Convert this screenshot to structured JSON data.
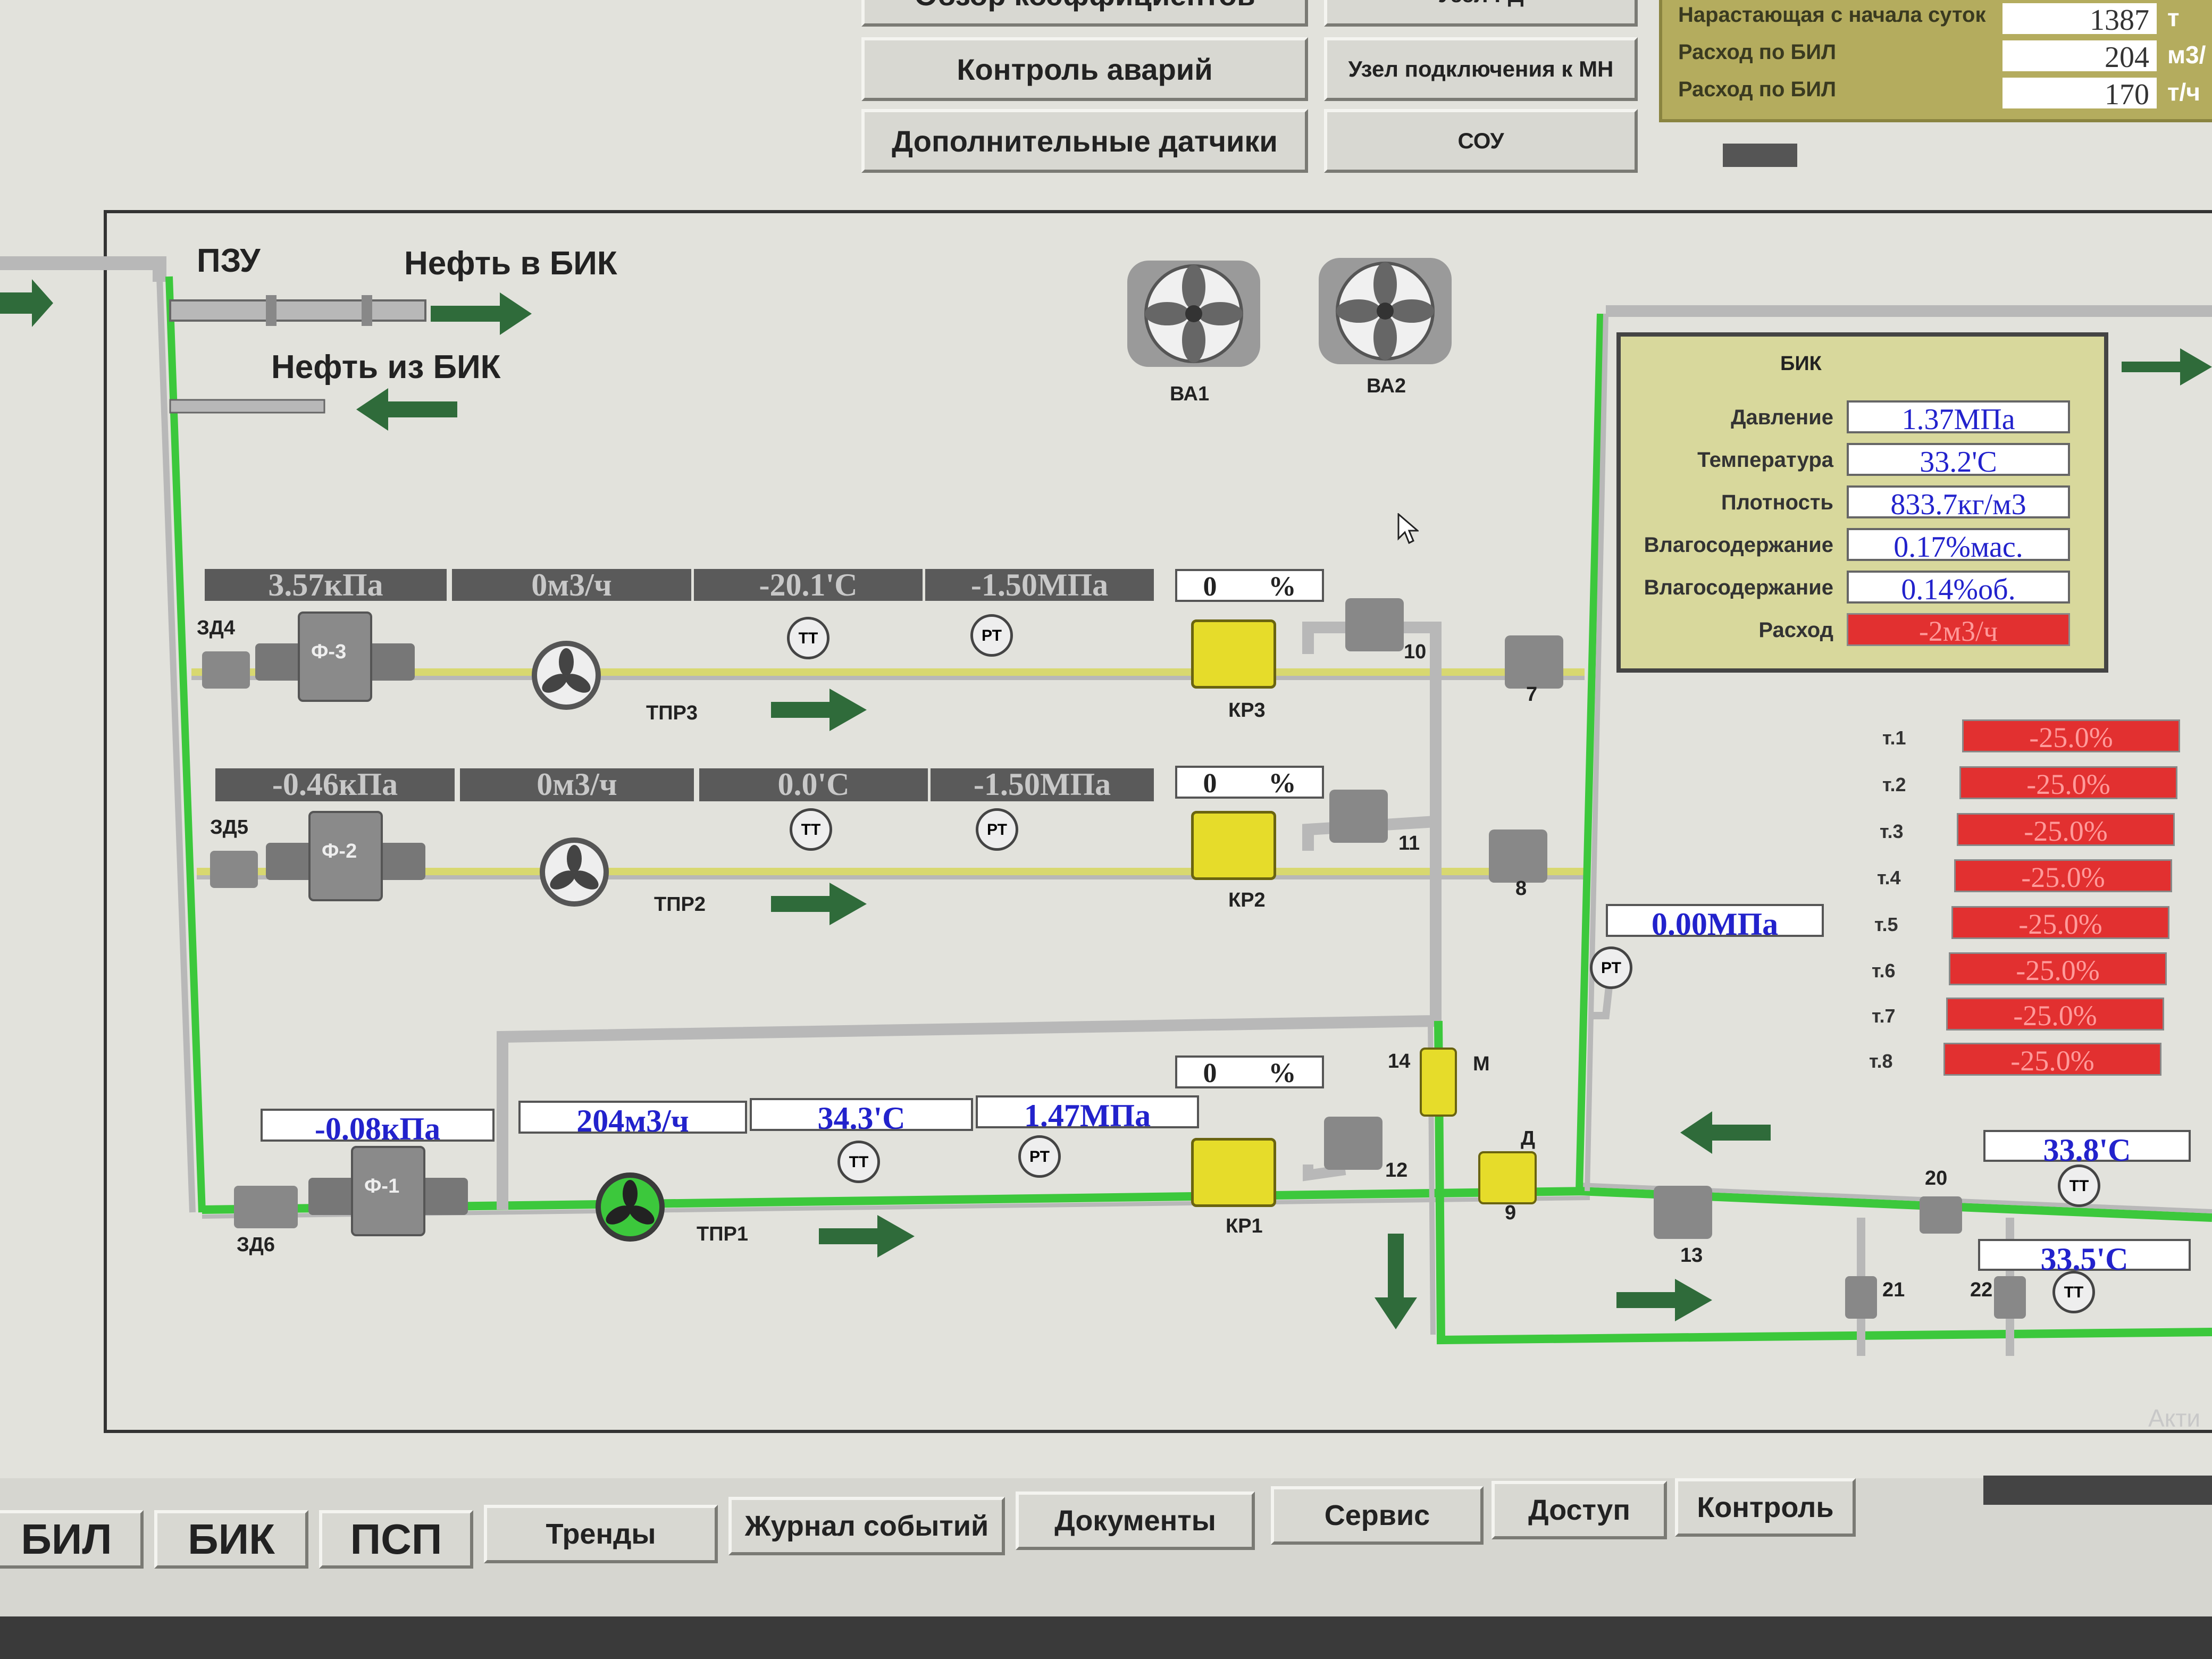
{
  "top_buttons": {
    "coefficients": "Обзор коэффициентов",
    "alarm_control": "Контроль аварий",
    "extra_sensors": "Дополнительные датчики",
    "node_rd": "Узел РД",
    "node_mn": "Узел подключения к МН",
    "sou": "СОУ"
  },
  "info_panel": {
    "rows": [
      {
        "label": "Нарастающая с начала суток",
        "value": "1387",
        "unit": "т"
      },
      {
        "label": "Расход по БИЛ",
        "value": "204",
        "unit": "м3/"
      },
      {
        "label": "Расход по БИЛ",
        "value": "170",
        "unit": "т/ч"
      }
    ]
  },
  "scheme": {
    "pzu": "ПЗУ",
    "oil_to_bik": "Нефть в БИК",
    "oil_from_bik": "Нефть из БИК",
    "fans": [
      {
        "label": "ВА1"
      },
      {
        "label": "ВА2"
      }
    ],
    "line3": {
      "dp": "3.57кПа",
      "flow": "0м3/ч",
      "temp": "-20.1'С",
      "pressure": "-1.50МПа",
      "valve_pct": "0",
      "pct_sign": "%",
      "valve_in": "ЗД4",
      "filter": "Ф-3",
      "meter": "ТПР3",
      "reg": "КР3",
      "v_a": "10",
      "v_b": "7",
      "tt": "ТТ",
      "pt": "РТ"
    },
    "line2": {
      "dp": "-0.46кПа",
      "flow": "0м3/ч",
      "temp": "0.0'С",
      "pressure": "-1.50МПа",
      "valve_pct": "0",
      "pct_sign": "%",
      "valve_in": "ЗД5",
      "filter": "Ф-2",
      "meter": "ТПР2",
      "reg": "КР2",
      "v_a": "11",
      "v_b": "8",
      "tt": "ТТ",
      "pt": "РТ"
    },
    "line1": {
      "dp": "-0.08кПа",
      "flow": "204м3/ч",
      "temp": "34.3'С",
      "pressure": "1.47МПа",
      "valve_pct": "0",
      "pct_sign": "%",
      "valve_in": "ЗД6",
      "filter": "Ф-1",
      "meter": "ТПР1",
      "reg": "КР1",
      "v_a": "12",
      "v_b": "9",
      "tt": "ТТ",
      "pt": "РТ"
    },
    "valve14": "14",
    "valve14_m": "М",
    "valve9_d": "Д",
    "valve13": "13",
    "valve20": "20",
    "valve21": "21",
    "valve22": "22",
    "pressure_right": "0.00МПа",
    "pt_right": "РТ",
    "temp_right1": "33.8'С",
    "temp_right2": "33.5'С",
    "tt_right": "ТТ"
  },
  "bik": {
    "title": "БИК",
    "rows": [
      {
        "label": "Давление",
        "value": "1.37МПа",
        "alarm": false
      },
      {
        "label": "Температура",
        "value": "33.2'С",
        "alarm": false
      },
      {
        "label": "Плотность",
        "value": "833.7кг/м3",
        "alarm": false
      },
      {
        "label": "Влагосодержание",
        "value": "0.17%мас.",
        "alarm": false
      },
      {
        "label": "Влагосодержание",
        "value": "0.14%об.",
        "alarm": false
      },
      {
        "label": "Расход",
        "value": "-2м3/ч",
        "alarm": true
      }
    ]
  },
  "sensors": [
    {
      "label": "т.1",
      "value": "-25.0%"
    },
    {
      "label": "т.2",
      "value": "-25.0%"
    },
    {
      "label": "т.3",
      "value": "-25.0%"
    },
    {
      "label": "т.4",
      "value": "-25.0%"
    },
    {
      "label": "т.5",
      "value": "-25.0%"
    },
    {
      "label": "т.6",
      "value": "-25.0%"
    },
    {
      "label": "т.7",
      "value": "-25.0%"
    },
    {
      "label": "т.8",
      "value": "-25.0%"
    }
  ],
  "bottom_nav": {
    "bil": "БИЛ",
    "bik": "БИК",
    "psp": "ПСП",
    "trends": "Тренды",
    "events": "Журнал событий",
    "documents": "Документы",
    "service": "Сервис",
    "access": "Доступ",
    "control": "Контроль"
  },
  "watermark": "Акти",
  "colors": {
    "active_pipe": "#3cc83c",
    "idle_pipe": "#d8d870",
    "pipe": "#b8b8b8",
    "alarm": "#e23030",
    "value_text": "#2222cc",
    "panel": "#d8d89c"
  }
}
